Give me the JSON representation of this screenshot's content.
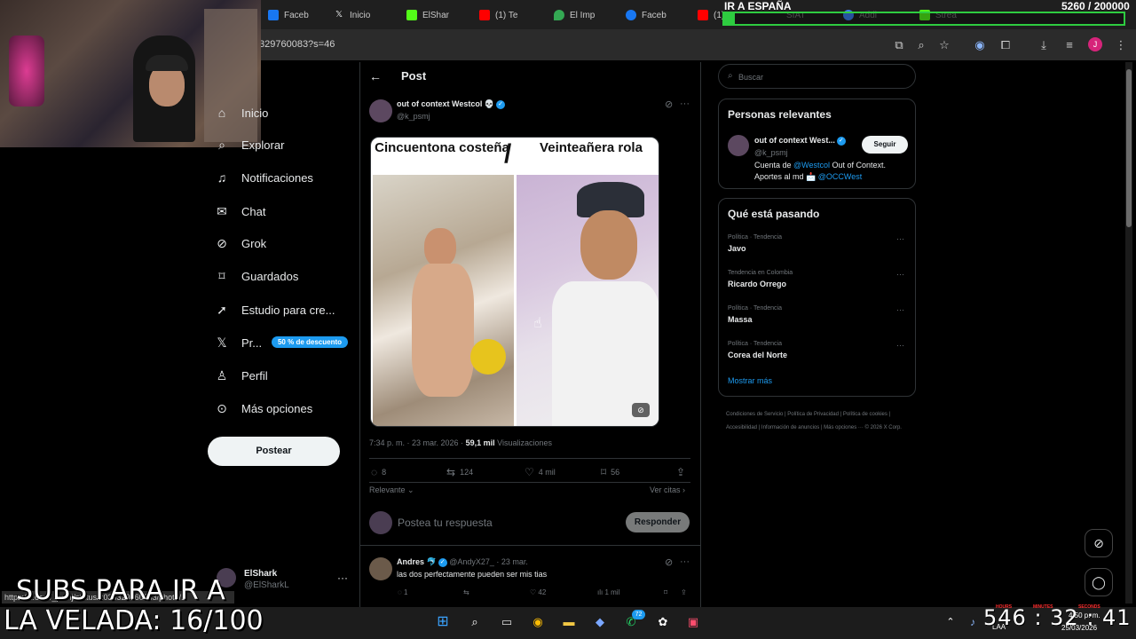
{
  "browser": {
    "tabs": [
      {
        "label": "Faceb",
        "color": "#1877f2"
      },
      {
        "label": "Inicio",
        "color": "#e7e9ea"
      },
      {
        "label": "ElShar",
        "color": "#53fc18"
      },
      {
        "label": "(1) Te",
        "color": "#ff0000"
      },
      {
        "label": "El Imp",
        "color": "#34a853"
      },
      {
        "label": "Faceb",
        "color": "#1877f2"
      },
      {
        "label": "(1)",
        "color": "#ff0000"
      },
      {
        "label": "SIAT",
        "color": "#777777"
      },
      {
        "label": "Addi",
        "color": "#3b82f6"
      },
      {
        "label": "Strea",
        "color": "#53fc18"
      }
    ],
    "url": "329760083?s=46",
    "status_url": "https://x.com/_psmj/status/2036329760083/photo/1"
  },
  "stream_overlay": {
    "goal_title": "IR A ESPAÑA",
    "goal_count": "5260 / 200000",
    "goal_progress": 0.026,
    "subs_line1": "SUBS PARA IR A",
    "subs_line2": "LA VELADA: 16/100",
    "timer": "546 : 32 : 41",
    "timer_labels": [
      "HOURS",
      "MINUTES",
      "SECONDS"
    ],
    "accent_color": "#2ecc40"
  },
  "sidebar": {
    "items": [
      {
        "label": "Inicio",
        "icon": "home-icon",
        "glyph": "⌂"
      },
      {
        "label": "Explorar",
        "icon": "search-icon",
        "glyph": "⌕"
      },
      {
        "label": "Notificaciones",
        "icon": "bell-icon",
        "glyph": "🔔︎"
      },
      {
        "label": "Chat",
        "icon": "mail-icon",
        "glyph": "✉"
      },
      {
        "label": "Grok",
        "icon": "grok-icon",
        "glyph": "⊘"
      },
      {
        "label": "Guardados",
        "icon": "bookmark-icon",
        "glyph": "⌑"
      },
      {
        "label": "Estudio para cre...",
        "icon": "rocket-icon",
        "glyph": "➚"
      },
      {
        "label": "Pr...",
        "icon": "x-logo-icon",
        "glyph": "𝕏"
      },
      {
        "label": "Perfil",
        "icon": "person-icon",
        "glyph": "♙"
      },
      {
        "label": "Más opciones",
        "icon": "more-circle-icon",
        "glyph": "⊙"
      }
    ],
    "premium_badge": "50 % de descuento",
    "post_button": "Postear",
    "account": {
      "name": "ElShark",
      "handle": "@ElSharkL"
    }
  },
  "post": {
    "header": "Post",
    "author_name": "out of context Westcol 💀",
    "author_handle": "@k_psmj",
    "media_left_label": "Cincuentona costeña",
    "media_right_label": "Veinteañera rola",
    "media_divider": "/",
    "timestamp": "7:34 p. m. · 23 mar. 2026 ·",
    "views_count": "59,1 mil",
    "views_label": "Visualizaciones",
    "replies": "8",
    "reposts": "124",
    "likes": "4 mil",
    "bookmarks": "56",
    "sort_label": "Relevante",
    "quotes_label": "Ver citas",
    "reply_placeholder": "Postea tu respuesta",
    "reply_button": "Responder"
  },
  "comment": {
    "name": "Andres 🐬",
    "handle": "@AndyX27_",
    "date": "· 23 mar.",
    "text": "las dos perfectamente pueden ser mis tias",
    "replies": "1",
    "likes": "42",
    "views": "1 mil"
  },
  "right": {
    "search_placeholder": "Buscar",
    "relevant_title": "Personas relevantes",
    "relevant_name": "out of context West...",
    "relevant_handle": "@k_psmj",
    "follow_label": "Seguir",
    "bio_prefix": "Cuenta de ",
    "bio_link1": "@Westcol",
    "bio_mid": " Out of Context. Aportes al md 📩 ",
    "bio_link2": "@OCCWest",
    "trends_title": "Qué está pasando",
    "trends": [
      {
        "category": "Política · Tendencia",
        "name": "Javo"
      },
      {
        "category": "Tendencia en Colombia",
        "name": "Ricardo Orrego"
      },
      {
        "category": "Política · Tendencia",
        "name": "Massa"
      },
      {
        "category": "Política · Tendencia",
        "name": "Corea del Norte"
      }
    ],
    "show_more": "Mostrar más",
    "footer": "Condiciones de Servicio | Política de Privacidad | Política de cookies | Accesibilidad | Información de anuncios | Más opciones ··· © 2026 X Corp."
  },
  "taskbar": {
    "time": "4:50 p. m.",
    "date": "25/03/2026",
    "lang": "LAA",
    "whatsapp_badge": "72"
  }
}
